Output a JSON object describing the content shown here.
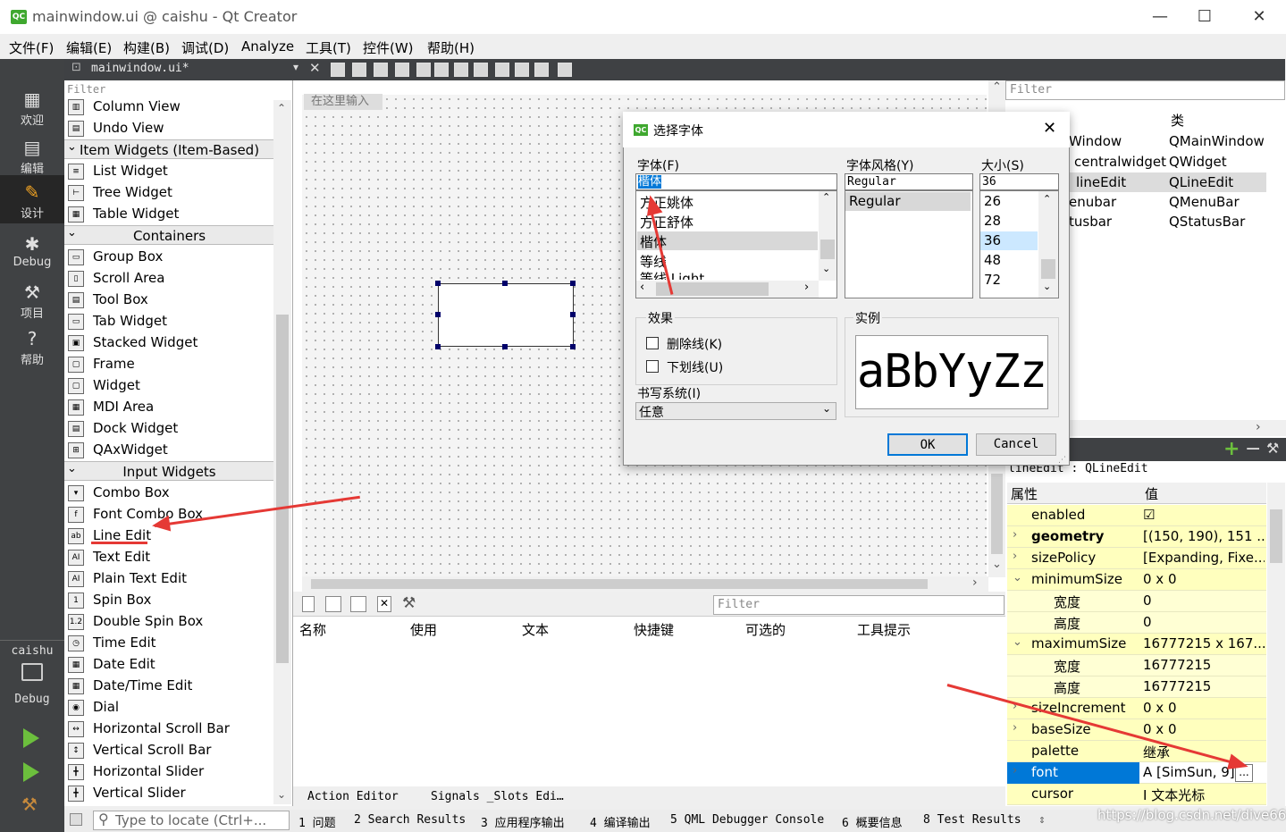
{
  "window": {
    "title": "mainwindow.ui @ caishu - Qt Creator",
    "app_badge": "QC",
    "minimize": "—",
    "maximize": "☐",
    "close": "✕"
  },
  "menu": [
    "文件(F)",
    "编辑(E)",
    "构建(B)",
    "调试(D)",
    "Analyze",
    "工具(T)",
    "控件(W)",
    "帮助(H)"
  ],
  "modes": [
    {
      "label": "欢迎",
      "icon": "grid-icon"
    },
    {
      "label": "编辑",
      "icon": "document-icon"
    },
    {
      "label": "设计",
      "icon": "pencil-icon"
    },
    {
      "label": "Debug",
      "icon": "bug-icon"
    },
    {
      "label": "项目",
      "icon": "wrench-icon"
    },
    {
      "label": "帮助",
      "icon": "help-icon"
    }
  ],
  "kit": {
    "project": "caishu",
    "mode": "Debug"
  },
  "doc": {
    "filename": "mainwindow.ui*"
  },
  "widgetbox": {
    "filter": "Filter",
    "entries": [
      {
        "kind": "item",
        "label": "Column View",
        "icon": "▥"
      },
      {
        "kind": "item",
        "label": "Undo View",
        "icon": "▤"
      },
      {
        "kind": "cat",
        "label": "Item Widgets (Item-Based)"
      },
      {
        "kind": "item",
        "label": "List Widget",
        "icon": "≡"
      },
      {
        "kind": "item",
        "label": "Tree Widget",
        "icon": "⊢"
      },
      {
        "kind": "item",
        "label": "Table Widget",
        "icon": "▦"
      },
      {
        "kind": "cat",
        "label": "Containers"
      },
      {
        "kind": "item",
        "label": "Group Box",
        "icon": "▭"
      },
      {
        "kind": "item",
        "label": "Scroll Area",
        "icon": "▯"
      },
      {
        "kind": "item",
        "label": "Tool Box",
        "icon": "▤"
      },
      {
        "kind": "item",
        "label": "Tab Widget",
        "icon": "▭"
      },
      {
        "kind": "item",
        "label": "Stacked Widget",
        "icon": "▣"
      },
      {
        "kind": "item",
        "label": "Frame",
        "icon": "▢"
      },
      {
        "kind": "item",
        "label": "Widget",
        "icon": "▢"
      },
      {
        "kind": "item",
        "label": "MDI Area",
        "icon": "▦"
      },
      {
        "kind": "item",
        "label": "Dock Widget",
        "icon": "▤"
      },
      {
        "kind": "item",
        "label": "QAxWidget",
        "icon": "⊞"
      },
      {
        "kind": "cat",
        "label": "Input Widgets"
      },
      {
        "kind": "item",
        "label": "Combo Box",
        "icon": "▾"
      },
      {
        "kind": "item",
        "label": "Font Combo Box",
        "icon": "f"
      },
      {
        "kind": "item",
        "label": "Line Edit",
        "icon": "ab"
      },
      {
        "kind": "item",
        "label": "Text Edit",
        "icon": "AI"
      },
      {
        "kind": "item",
        "label": "Plain Text Edit",
        "icon": "AI"
      },
      {
        "kind": "item",
        "label": "Spin Box",
        "icon": "1"
      },
      {
        "kind": "item",
        "label": "Double Spin Box",
        "icon": "1.2"
      },
      {
        "kind": "item",
        "label": "Time Edit",
        "icon": "◷"
      },
      {
        "kind": "item",
        "label": "Date Edit",
        "icon": "▦"
      },
      {
        "kind": "item",
        "label": "Date/Time Edit",
        "icon": "▦"
      },
      {
        "kind": "item",
        "label": "Dial",
        "icon": "◉"
      },
      {
        "kind": "item",
        "label": "Horizontal Scroll Bar",
        "icon": "↔"
      },
      {
        "kind": "item",
        "label": "Vertical Scroll Bar",
        "icon": "↕"
      },
      {
        "kind": "item",
        "label": "Horizontal Slider",
        "icon": "╋"
      },
      {
        "kind": "item",
        "label": "Vertical Slider",
        "icon": "╋"
      }
    ]
  },
  "form": {
    "type_here": "在这里输入"
  },
  "action_editor": {
    "filter": "Filter",
    "columns": [
      "名称",
      "使用",
      "文本",
      "快捷键",
      "可选的",
      "工具提示"
    ],
    "tabs": [
      "Action Editor",
      "Signals _Slots Edi…"
    ]
  },
  "object_inspector": {
    "filter": "Filter",
    "header_class": "类",
    "rows": [
      {
        "name": "Window",
        "class": "QMainWindow"
      },
      {
        "name": "centralwidget",
        "class": "QWidget"
      },
      {
        "name": "lineEdit",
        "class": "QLineEdit"
      },
      {
        "name": "enubar",
        "class": "QMenuBar"
      },
      {
        "name": "tusbar",
        "class": "QStatusBar"
      }
    ]
  },
  "property_editor": {
    "context": "lineEdit : QLineEdit",
    "header_name": "属性",
    "header_value": "值",
    "rows": [
      {
        "name": "enabled",
        "value": "☑",
        "bold": false,
        "sub": false,
        "expand": ""
      },
      {
        "name": "geometry",
        "value": "[(150, 190), 151 ...",
        "bold": true,
        "sub": false,
        "expand": "›"
      },
      {
        "name": "sizePolicy",
        "value": "[Expanding, Fixe...",
        "bold": false,
        "sub": false,
        "expand": "›"
      },
      {
        "name": "minimumSize",
        "value": "0 x 0",
        "bold": false,
        "sub": false,
        "expand": "⌄"
      },
      {
        "name": "宽度",
        "value": "0",
        "bold": false,
        "sub": true,
        "expand": ""
      },
      {
        "name": "高度",
        "value": "0",
        "bold": false,
        "sub": true,
        "expand": ""
      },
      {
        "name": "maximumSize",
        "value": "16777215 x 167...",
        "bold": false,
        "sub": false,
        "expand": "⌄"
      },
      {
        "name": "宽度",
        "value": "16777215",
        "bold": false,
        "sub": true,
        "expand": ""
      },
      {
        "name": "高度",
        "value": "16777215",
        "bold": false,
        "sub": true,
        "expand": ""
      },
      {
        "name": "sizeIncrement",
        "value": "0 x 0",
        "bold": false,
        "sub": false,
        "expand": "›"
      },
      {
        "name": "baseSize",
        "value": "0 x 0",
        "bold": false,
        "sub": false,
        "expand": "›"
      },
      {
        "name": "palette",
        "value": "继承",
        "bold": false,
        "sub": false,
        "expand": ""
      },
      {
        "name": "font",
        "value": "A [SimSun, 9]",
        "bold": false,
        "sub": false,
        "expand": "›",
        "selected": true
      },
      {
        "name": "cursor",
        "value": "I  文本光标",
        "bold": false,
        "sub": false,
        "expand": ""
      }
    ],
    "more_button": "..."
  },
  "statusbar": {
    "locate_placeholder": "Type to locate (Ctrl+...",
    "tabs": [
      "1 问题",
      "2 Search Results",
      "3 应用程序输出",
      "4 编译输出",
      "5 QML Debugger Console",
      "6 概要信息",
      "8 Test Results"
    ]
  },
  "watermark": "https://blog.csdn.net/dive668",
  "font_dialog": {
    "title": "选择字体",
    "font_label": "字体(F)",
    "style_label": "字体风格(Y)",
    "size_label": "大小(S)",
    "font_value": "楷体",
    "style_value": "Regular",
    "size_value": "36",
    "fonts": [
      "方正姚体",
      "方正舒体",
      "楷体",
      "等线",
      "等线 Light"
    ],
    "selected_font": "楷体",
    "styles": [
      "Regular"
    ],
    "sizes": [
      "26",
      "28",
      "36",
      "48",
      "72"
    ],
    "effects_label": "效果",
    "strikeout": "删除线(K)",
    "underline": "下划线(U)",
    "sample_label": "实例",
    "sample_text": "aBbYyZz",
    "writing_system_label": "书写系统(I)",
    "writing_system": "任意",
    "ok": "OK",
    "cancel": "Cancel"
  }
}
